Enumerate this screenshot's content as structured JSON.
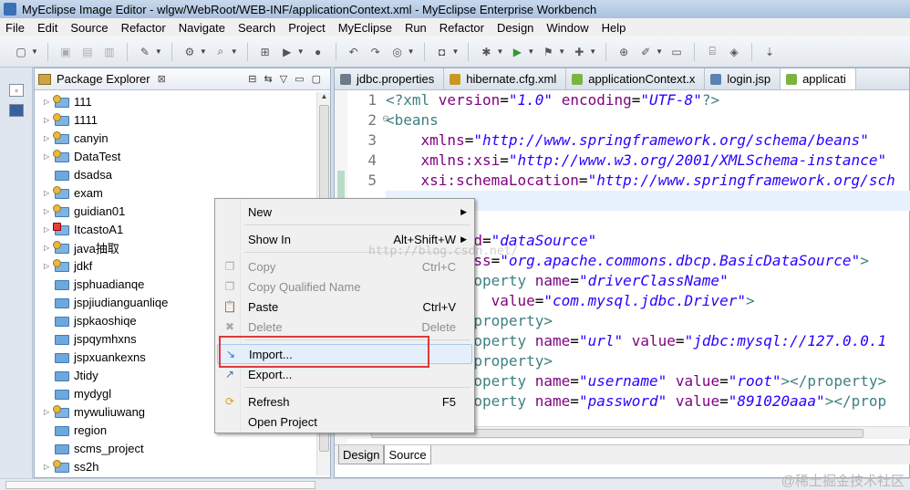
{
  "window": {
    "title": "MyEclipse Image Editor - wlgw/WebRoot/WEB-INF/applicationContext.xml - MyEclipse Enterprise Workbench"
  },
  "menubar": [
    "File",
    "Edit",
    "Source",
    "Refactor",
    "Navigate",
    "Search",
    "Project",
    "MyEclipse",
    "Run",
    "Refactor",
    "Design",
    "Window",
    "Help"
  ],
  "explorer": {
    "title": "Package Explorer",
    "projects": [
      {
        "name": "111",
        "type": "badge",
        "expandable": true
      },
      {
        "name": "1111",
        "type": "badge",
        "expandable": true
      },
      {
        "name": "canyin",
        "type": "badge",
        "expandable": true
      },
      {
        "name": "DataTest",
        "type": "badge",
        "expandable": true
      },
      {
        "name": "dsadsa",
        "type": "plain",
        "expandable": false
      },
      {
        "name": "exam",
        "type": "badge",
        "expandable": true
      },
      {
        "name": "guidian01",
        "type": "badge",
        "expandable": true
      },
      {
        "name": "ItcastoA1",
        "type": "error",
        "expandable": true
      },
      {
        "name": "java抽取",
        "type": "badge",
        "expandable": true
      },
      {
        "name": "jdkf",
        "type": "badge",
        "expandable": true
      },
      {
        "name": "jsphuadianqe",
        "type": "plain",
        "expandable": false
      },
      {
        "name": "jspjiudianguanliqe",
        "type": "plain",
        "expandable": false
      },
      {
        "name": "jspkaoshiqe",
        "type": "plain",
        "expandable": false
      },
      {
        "name": "jspqymhxns",
        "type": "plain",
        "expandable": false
      },
      {
        "name": "jspxuankexns",
        "type": "plain",
        "expandable": false
      },
      {
        "name": "Jtidy",
        "type": "plain",
        "expandable": false
      },
      {
        "name": "mydygl",
        "type": "plain",
        "expandable": false
      },
      {
        "name": "mywuliuwang",
        "type": "badge",
        "expandable": true
      },
      {
        "name": "region",
        "type": "plain",
        "expandable": false
      },
      {
        "name": "scms_project",
        "type": "plain",
        "expandable": false
      },
      {
        "name": "ss2h",
        "type": "badge",
        "expandable": true
      }
    ]
  },
  "editor": {
    "tabs": [
      {
        "label": "jdbc.properties",
        "color": "#6d7b8d",
        "active": false
      },
      {
        "label": "hibernate.cfg.xml",
        "color": "#c79a1e",
        "active": false
      },
      {
        "label": "applicationContext.x",
        "color": "#7bb540",
        "active": false
      },
      {
        "label": "login.jsp",
        "color": "#5b82b5",
        "active": false
      },
      {
        "label": "applicati",
        "color": "#7bb540",
        "active": true
      }
    ],
    "line_numbers": [
      "1",
      "2",
      "3",
      "4",
      "5",
      "",
      "",
      "",
      "",
      "",
      "",
      "",
      "",
      "",
      "",
      ""
    ],
    "lines": [
      [
        [
          "c-tag",
          "<?xml "
        ],
        [
          "c-attr",
          "version"
        ],
        [
          "c-plain",
          "="
        ],
        [
          "c-str",
          "\"1.0\""
        ],
        [
          "c-plain",
          " "
        ],
        [
          "c-attr",
          "encoding"
        ],
        [
          "c-plain",
          "="
        ],
        [
          "c-str",
          "\"UTF-8\""
        ],
        [
          "c-tag",
          "?>"
        ]
      ],
      [
        [
          "c-tag",
          "<beans"
        ]
      ],
      [
        [
          "c-plain",
          "    "
        ],
        [
          "c-attr",
          "xmlns"
        ],
        [
          "c-plain",
          "="
        ],
        [
          "c-str",
          "\"http://www.springframework.org/schema/beans\""
        ]
      ],
      [
        [
          "c-plain",
          "    "
        ],
        [
          "c-attr",
          "xmlns:xsi"
        ],
        [
          "c-plain",
          "="
        ],
        [
          "c-str",
          "\"http://www.w3.org/2001/XMLSchema-instance\""
        ]
      ],
      [
        [
          "c-plain",
          "    "
        ],
        [
          "c-attr",
          "xsi:schemaLocation"
        ],
        [
          "c-plain",
          "="
        ],
        [
          "c-str",
          "\"http://www.springframework.org/sch"
        ]
      ],
      [
        [
          "c-plain",
          ""
        ]
      ],
      [
        [
          "c-plain",
          ""
        ]
      ],
      [
        [
          "c-plain",
          "         "
        ],
        [
          "c-attr",
          "id"
        ],
        [
          "c-plain",
          "="
        ],
        [
          "c-str",
          "\"dataSource\""
        ]
      ],
      [
        [
          "c-plain",
          "         "
        ],
        [
          "c-attr",
          "ass"
        ],
        [
          "c-plain",
          "="
        ],
        [
          "c-str",
          "\"org.apache.commons.dbcp.BasicDataSource\""
        ],
        [
          "c-tag",
          ">"
        ]
      ],
      [
        [
          "c-plain",
          "         "
        ],
        [
          "c-tag",
          "roperty "
        ],
        [
          "c-attr",
          "name"
        ],
        [
          "c-plain",
          "="
        ],
        [
          "c-str",
          "\"driverClassName\""
        ]
      ],
      [
        [
          "c-plain",
          "            "
        ],
        [
          "c-attr",
          "value"
        ],
        [
          "c-plain",
          "="
        ],
        [
          "c-str",
          "\"com.mysql.jdbc.Driver\""
        ],
        [
          "c-tag",
          ">"
        ]
      ],
      [
        [
          "c-plain",
          "         "
        ],
        [
          "c-tag",
          "/property>"
        ]
      ],
      [
        [
          "c-plain",
          "         "
        ],
        [
          "c-tag",
          "roperty "
        ],
        [
          "c-attr",
          "name"
        ],
        [
          "c-plain",
          "="
        ],
        [
          "c-str",
          "\"url\""
        ],
        [
          "c-plain",
          " "
        ],
        [
          "c-attr",
          "value"
        ],
        [
          "c-plain",
          "="
        ],
        [
          "c-str",
          "\"jdbc:mysql://127.0.0.1"
        ]
      ],
      [
        [
          "c-plain",
          "         "
        ],
        [
          "c-tag",
          "/property>"
        ]
      ],
      [
        [
          "c-plain",
          "         "
        ],
        [
          "c-tag",
          "roperty "
        ],
        [
          "c-attr",
          "name"
        ],
        [
          "c-plain",
          "="
        ],
        [
          "c-str",
          "\"username\""
        ],
        [
          "c-plain",
          " "
        ],
        [
          "c-attr",
          "value"
        ],
        [
          "c-plain",
          "="
        ],
        [
          "c-str",
          "\"root\""
        ],
        [
          "c-tag",
          "></property>"
        ]
      ],
      [
        [
          "c-plain",
          "         "
        ],
        [
          "c-tag",
          "roperty "
        ],
        [
          "c-attr",
          "name"
        ],
        [
          "c-plain",
          "="
        ],
        [
          "c-str",
          "\"password\""
        ],
        [
          "c-plain",
          " "
        ],
        [
          "c-attr",
          "value"
        ],
        [
          "c-plain",
          "="
        ],
        [
          "c-str",
          "\"891020aaa\""
        ],
        [
          "c-tag",
          "></prop"
        ]
      ]
    ],
    "bottom_tabs": [
      {
        "label": "Design",
        "active": false
      },
      {
        "label": "Source",
        "active": true
      }
    ]
  },
  "context_menu": {
    "items": [
      {
        "label": "New",
        "accel": "",
        "submenu": true,
        "disabled": false,
        "icon": "",
        "hover": false
      },
      {
        "sep": true
      },
      {
        "label": "Show In",
        "accel": "Alt+Shift+W",
        "submenu": true,
        "disabled": false,
        "icon": "",
        "hover": false
      },
      {
        "sep": true
      },
      {
        "label": "Copy",
        "accel": "Ctrl+C",
        "submenu": false,
        "disabled": true,
        "icon": "copy-icon",
        "hover": false
      },
      {
        "label": "Copy Qualified Name",
        "accel": "",
        "submenu": false,
        "disabled": true,
        "icon": "copy-qualified-icon",
        "hover": false
      },
      {
        "label": "Paste",
        "accel": "Ctrl+V",
        "submenu": false,
        "disabled": false,
        "icon": "paste-icon",
        "hover": false
      },
      {
        "label": "Delete",
        "accel": "Delete",
        "submenu": false,
        "disabled": true,
        "icon": "delete-icon",
        "hover": false
      },
      {
        "sep": true
      },
      {
        "label": "Import...",
        "accel": "",
        "submenu": false,
        "disabled": false,
        "icon": "import-icon",
        "hover": true
      },
      {
        "label": "Export...",
        "accel": "",
        "submenu": false,
        "disabled": false,
        "icon": "export-icon",
        "hover": false
      },
      {
        "sep": true
      },
      {
        "label": "Refresh",
        "accel": "F5",
        "submenu": false,
        "disabled": false,
        "icon": "refresh-icon",
        "hover": false
      },
      {
        "label": "Open Project",
        "accel": "",
        "submenu": false,
        "disabled": false,
        "icon": "",
        "hover": false
      }
    ]
  },
  "watermark": "http://blog.csdn.net/",
  "watermark_bottom": "@稀土掘金技术社区",
  "colors": {
    "highlight": "#e03a3a",
    "selection": "#3399ff",
    "menu_hover": "#e5effb"
  }
}
